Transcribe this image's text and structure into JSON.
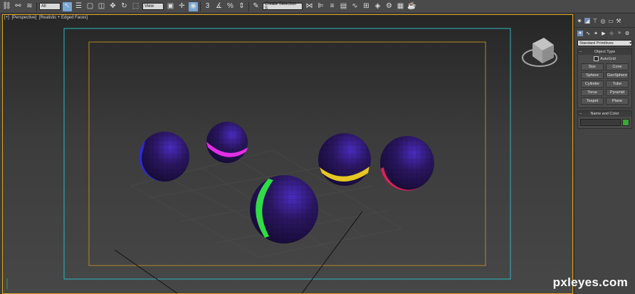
{
  "toolbar": {
    "selection_filter": "All",
    "ref_coord": "View",
    "named_selection": "Create Selection S"
  },
  "viewport": {
    "label_plus": "[+]",
    "label_view": "[Perspective]",
    "label_shading": "[Realistic + Edged Faces]"
  },
  "command_panel": {
    "category": "Standard Primitives",
    "object_type": {
      "title": "Object Type",
      "autogrid": "AutoGrid",
      "buttons": [
        "Box",
        "Cone",
        "Sphere",
        "GeoSphere",
        "Cylinder",
        "Tube",
        "Torus",
        "Pyramid",
        "Teapot",
        "Plane"
      ]
    },
    "name_and_color": {
      "title": "Name and Color",
      "color": "#3da637"
    }
  },
  "watermark": "pxleyes.com",
  "scene": {
    "spheres": [
      {
        "name": "sphere-blue-rim",
        "rim_color": "#2e2bd6"
      },
      {
        "name": "sphere-magenta-band",
        "rim_color": "#e42ee6"
      },
      {
        "name": "sphere-green-band",
        "rim_color": "#2fdc46"
      },
      {
        "name": "sphere-yellow-band",
        "rim_color": "#e6c722"
      },
      {
        "name": "sphere-red-rim",
        "rim_color": "#e0205a"
      }
    ],
    "body_color": "#2a1660",
    "frame_outer": "#2bb8c2",
    "frame_inner": "#b0882a"
  }
}
